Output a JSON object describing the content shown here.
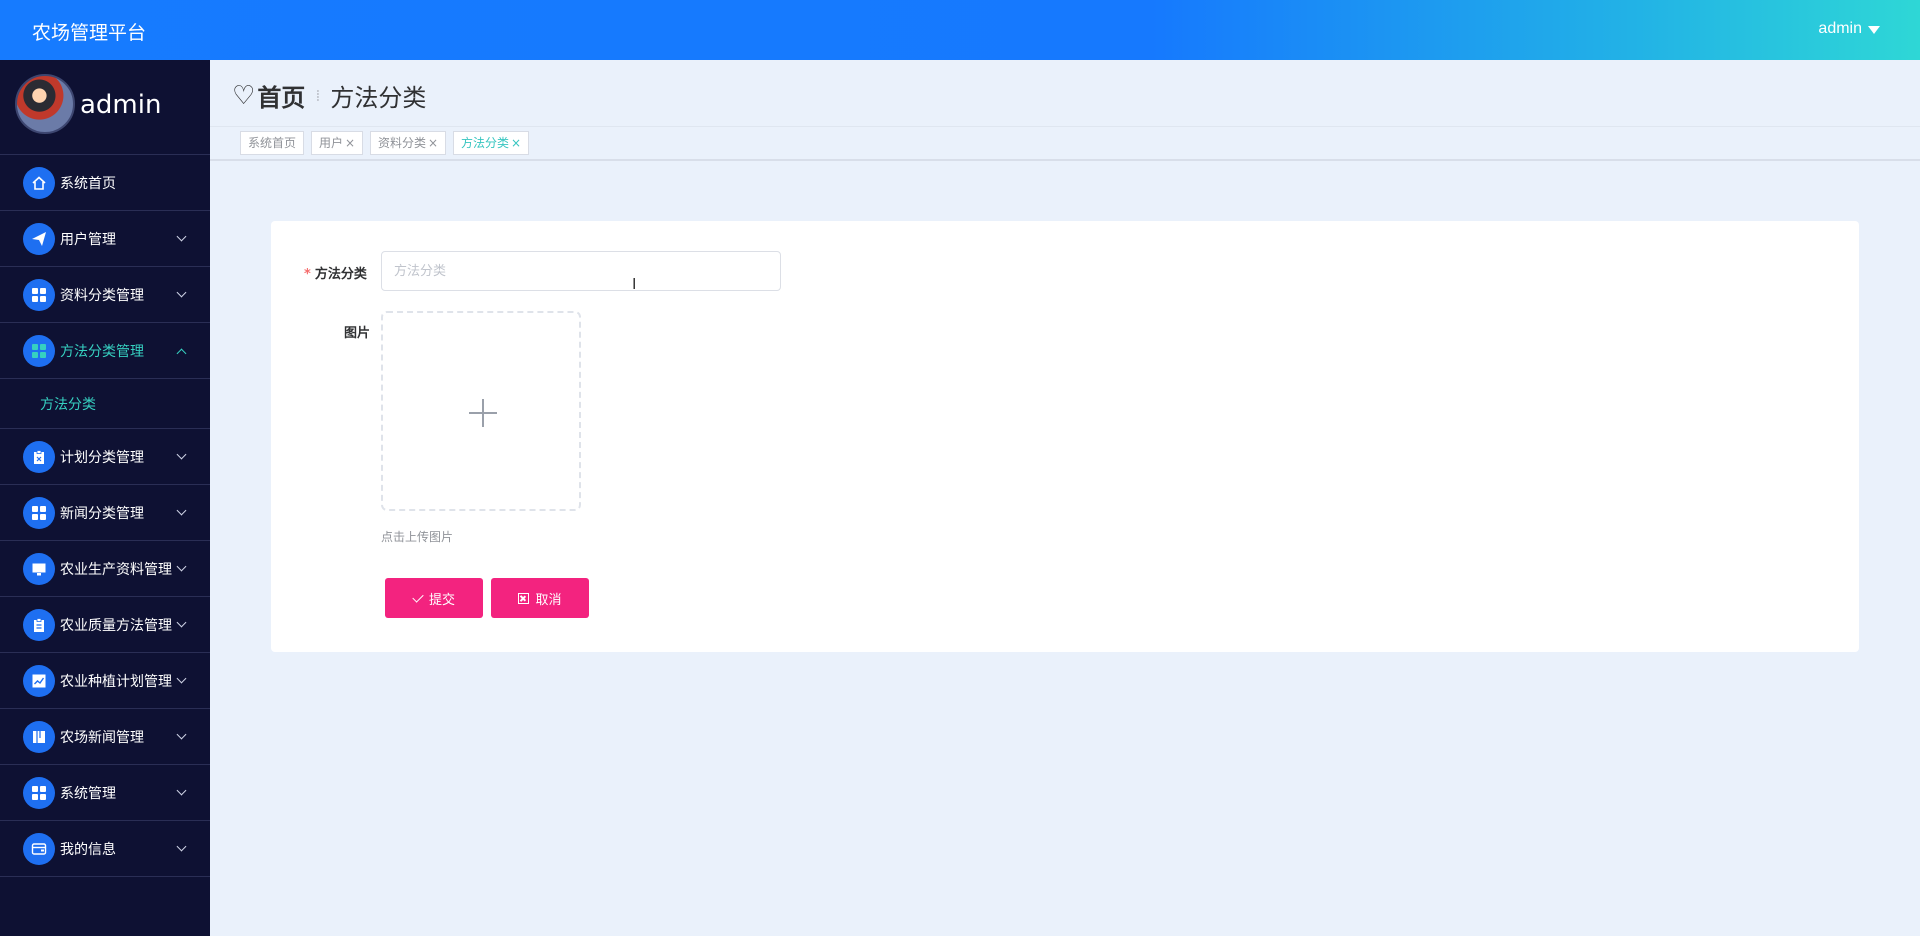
{
  "topbar": {
    "brand": "农场管理平台",
    "user": "admin"
  },
  "sidebar": {
    "profile_name": "admin",
    "items": [
      {
        "label": "系统首页",
        "icon": "home-icon"
      },
      {
        "label": "用户管理",
        "icon": "paper-plane-icon"
      },
      {
        "label": "资料分类管理",
        "icon": "grid-icon"
      },
      {
        "label": "方法分类管理",
        "icon": "grid-icon"
      },
      {
        "label": "计划分类管理",
        "icon": "clipboard-icon"
      },
      {
        "label": "新闻分类管理",
        "icon": "grid-icon"
      },
      {
        "label": "农业生产资料管理",
        "icon": "monitor-icon"
      },
      {
        "label": "农业质量方法管理",
        "icon": "clipboard-icon"
      },
      {
        "label": "农业种植计划管理",
        "icon": "chart-icon"
      },
      {
        "label": "农场新闻管理",
        "icon": "book-icon"
      },
      {
        "label": "系统管理",
        "icon": "grid-icon"
      },
      {
        "label": "我的信息",
        "icon": "wallet-icon"
      }
    ],
    "submenu": {
      "label": "方法分类"
    }
  },
  "breadcrumb": {
    "home": "首页",
    "current": "方法分类"
  },
  "tags": [
    {
      "label": "系统首页"
    },
    {
      "label": "用户"
    },
    {
      "label": "资料分类"
    },
    {
      "label": "方法分类"
    }
  ],
  "form": {
    "field_label": "方法分类",
    "field_placeholder": "方法分类",
    "field_value": "",
    "image_label": "图片",
    "upload_hint": "点击上传图片",
    "submit": "提交",
    "cancel": "取消"
  },
  "colors": {
    "accent": "#36d0c0",
    "primary": "#1e6ff1",
    "button": "#f3237f",
    "sidebar": "#0e1133"
  }
}
